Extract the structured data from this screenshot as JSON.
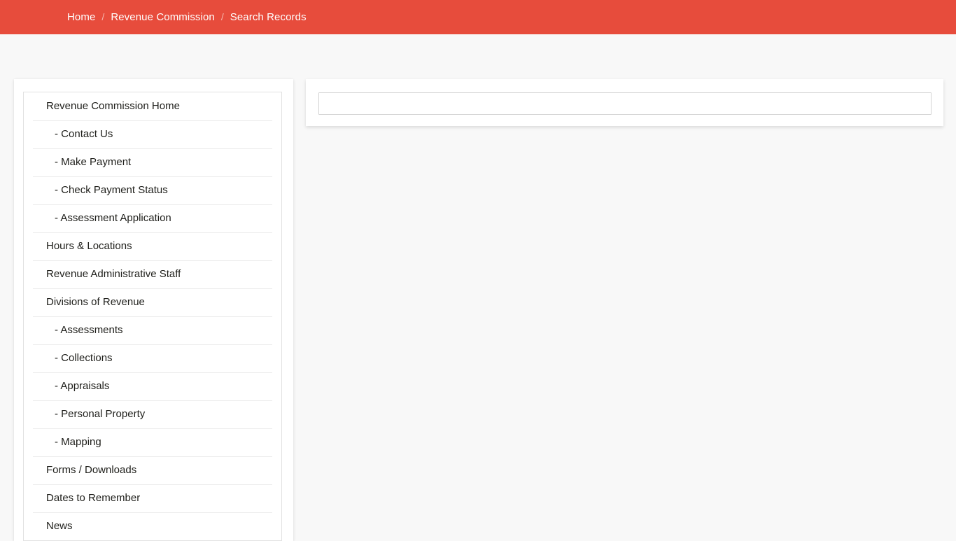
{
  "theme": {
    "accent": "#e74c3c",
    "page_background": "#f8f8f8",
    "card_background": "#ffffff",
    "divider": "#ececec",
    "text": "#20201c",
    "breadcrumb_separator_color": "#f3b7ae"
  },
  "breadcrumb": {
    "separator": "/",
    "items": [
      {
        "label": "Home"
      },
      {
        "label": "Revenue Commission"
      },
      {
        "label": "Search Records"
      }
    ]
  },
  "sidebar": {
    "items": [
      {
        "label": "Revenue Commission Home",
        "sub": false
      },
      {
        "label": "Contact Us",
        "sub": true
      },
      {
        "label": "Make Payment",
        "sub": true
      },
      {
        "label": "Check Payment Status",
        "sub": true
      },
      {
        "label": "Assessment Application",
        "sub": true
      },
      {
        "label": "Hours & Locations",
        "sub": false
      },
      {
        "label": "Revenue Administrative Staff",
        "sub": false
      },
      {
        "label": "Divisions of Revenue",
        "sub": false
      },
      {
        "label": "Assessments",
        "sub": true
      },
      {
        "label": "Collections",
        "sub": true
      },
      {
        "label": "Appraisals",
        "sub": true
      },
      {
        "label": "Personal Property",
        "sub": true
      },
      {
        "label": "Mapping",
        "sub": true
      },
      {
        "label": "Forms / Downloads",
        "sub": false
      },
      {
        "label": "Dates to Remember",
        "sub": false
      },
      {
        "label": "News",
        "sub": false
      }
    ],
    "sub_prefix": "- "
  },
  "search": {
    "value": "",
    "placeholder": ""
  }
}
